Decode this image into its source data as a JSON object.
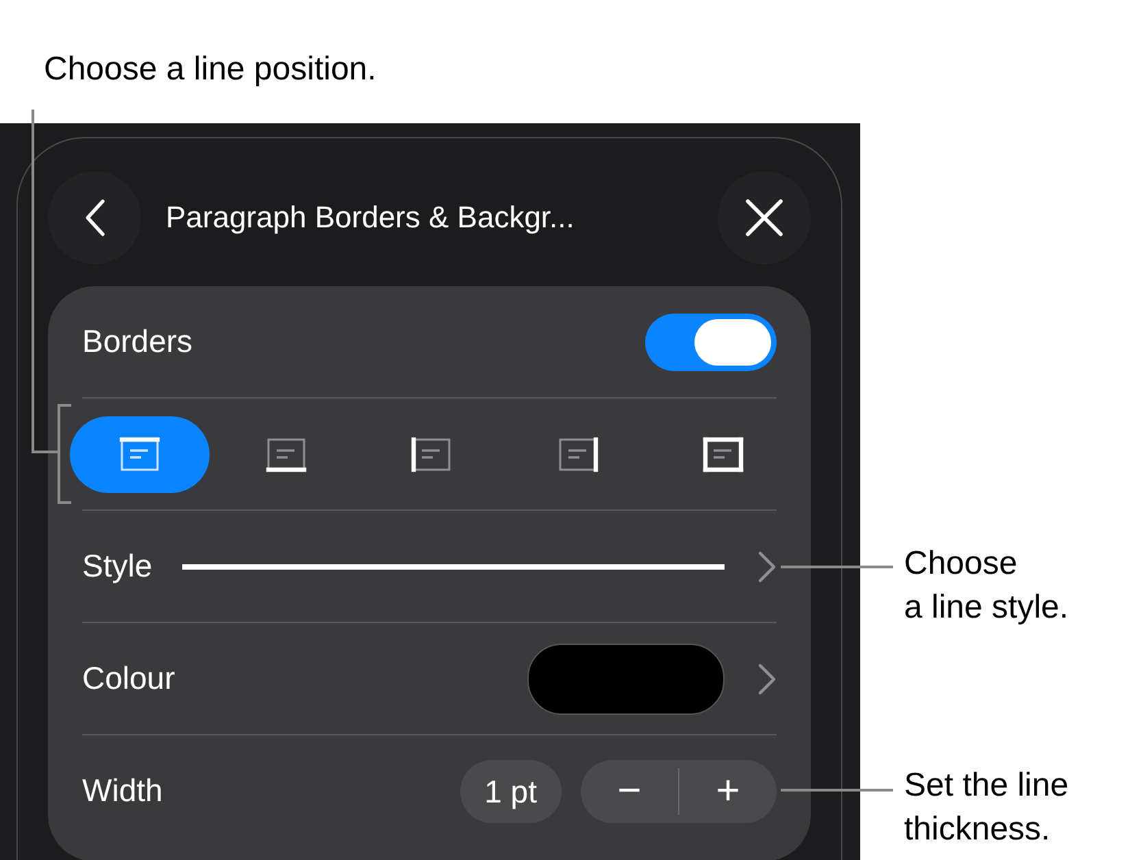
{
  "callouts": [
    {
      "kind": "top",
      "text": "Choose a line position."
    },
    {
      "kind": "style",
      "text": "Choose\na line style."
    },
    {
      "kind": "width",
      "text": "Set the line\nthickness."
    }
  ],
  "header": {
    "title": "Paragraph Borders & Backgr..."
  },
  "borders": {
    "label": "Borders",
    "on": true
  },
  "positions": [
    {
      "kind": "top",
      "selected": true
    },
    {
      "kind": "bottom",
      "selected": false
    },
    {
      "kind": "left",
      "selected": false
    },
    {
      "kind": "right",
      "selected": false
    },
    {
      "kind": "all",
      "selected": false
    }
  ],
  "style": {
    "label": "Style"
  },
  "colour": {
    "label": "Colour"
  },
  "width": {
    "label": "Width",
    "value": "1 pt",
    "decrease": "−",
    "increase": "+"
  }
}
